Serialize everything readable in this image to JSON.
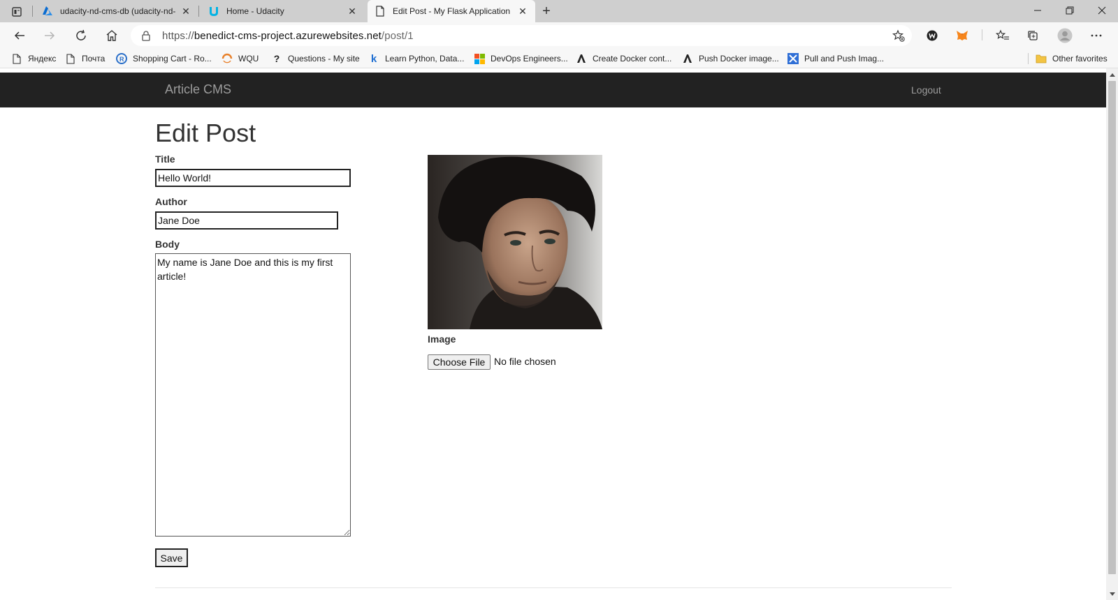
{
  "browser": {
    "tabs": [
      {
        "title": "udacity-nd-cms-db (udacity-nd-",
        "favicon": "azure-icon",
        "active": false
      },
      {
        "title": "Home - Udacity",
        "favicon": "udacity-icon",
        "active": false
      },
      {
        "title": "Edit Post - My Flask Application",
        "favicon": "page-icon",
        "active": true
      }
    ],
    "address": {
      "scheme": "https://",
      "host": "benedict-cms-project.azurewebsites.net",
      "path": "/post/1"
    },
    "bookmarks": [
      {
        "label": "Яндекс",
        "icon": "page-icon"
      },
      {
        "label": "Почта",
        "icon": "page-icon"
      },
      {
        "label": "Shopping Cart - Ro...",
        "icon": "r-icon"
      },
      {
        "label": "WQU",
        "icon": "wqu-icon"
      },
      {
        "label": "Questions - My site",
        "icon": "question-icon"
      },
      {
        "label": "Learn Python, Data...",
        "icon": "k-icon"
      },
      {
        "label": "DevOps Engineers...",
        "icon": "windows-icon"
      },
      {
        "label": "Create Docker cont...",
        "icon": "a-icon"
      },
      {
        "label": "Push Docker image...",
        "icon": "a-icon"
      },
      {
        "label": "Pull and Push Imag...",
        "icon": "x-icon"
      }
    ],
    "other_favorites": "Other favorites"
  },
  "app": {
    "brand": "Article CMS",
    "logout": "Logout"
  },
  "form": {
    "heading": "Edit Post",
    "title_label": "Title",
    "title_value": "Hello World!",
    "author_label": "Author",
    "author_value": "Jane Doe",
    "body_label": "Body",
    "body_value": "My name is Jane Doe and this is my first article!",
    "save_label": "Save",
    "image_label": "Image",
    "file_button": "Choose File",
    "file_status": "No file chosen"
  },
  "colors": {
    "navbar": "#222222",
    "nav_text": "#9d9d9d",
    "tabstrip": "#cfcfcf"
  }
}
